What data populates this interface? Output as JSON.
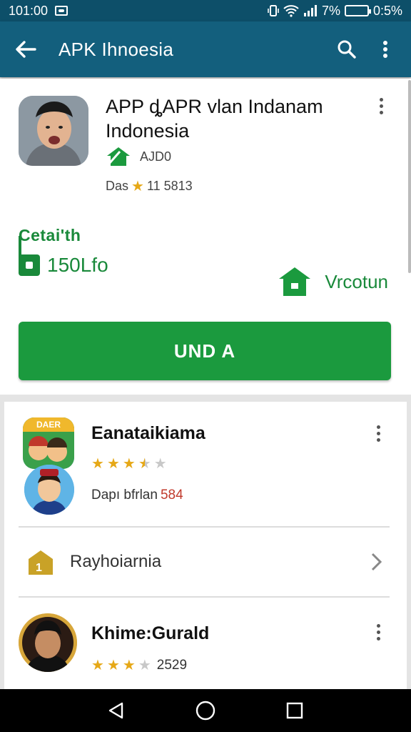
{
  "status": {
    "time": "101:00",
    "battery_pct": "7%",
    "clock_right": "0:5%"
  },
  "toolbar": {
    "title": "APK Ihnoesia"
  },
  "app": {
    "title": "APP ȡAPR vlan Indanam Indonesia",
    "developer": "AJD0",
    "rating_prefix": "Das",
    "rating_text": "11 5813",
    "detail_label": "Cetai'th",
    "detail_value": "150Lfo",
    "version_label": "Vrcotun",
    "install_label": "UND A"
  },
  "list": {
    "items": [
      {
        "title": "Eanataikiama",
        "sub_prefix": "Dapı bfrlan",
        "sub_value": "584",
        "stars": 3.5,
        "icon_caption": "DAER"
      },
      {
        "title": "Rayhoiarnia"
      },
      {
        "title": "Khime:Gurald",
        "rating_text": "2529",
        "stars": 3
      }
    ]
  },
  "colors": {
    "statusbar": "#0d4f69",
    "toolbar": "#135f7d",
    "accent_green": "#1b9a3e",
    "star": "#e6a817"
  },
  "icons": [
    "back-arrow-icon",
    "search-icon",
    "more-vert-icon",
    "house-icon",
    "download-icon",
    "chevron-right-icon",
    "nav-back-icon",
    "nav-home-icon",
    "nav-recents-icon"
  ]
}
